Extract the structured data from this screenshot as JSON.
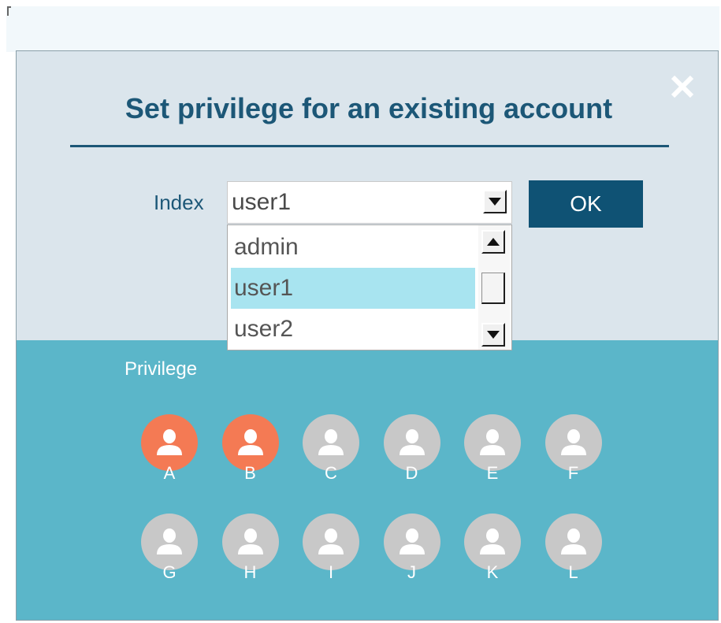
{
  "dialog": {
    "title": "Set privilege for an existing account",
    "close_icon": "close-icon",
    "index_label": "Index",
    "selected_value": "user1",
    "ok_label": "OK",
    "privilege_label": "Privilege",
    "dropdown_options": [
      "admin",
      "user1",
      "user2"
    ],
    "highlighted_option": "user1"
  },
  "privileges": [
    {
      "letter": "A",
      "active": true
    },
    {
      "letter": "B",
      "active": true
    },
    {
      "letter": "C",
      "active": false
    },
    {
      "letter": "D",
      "active": false
    },
    {
      "letter": "E",
      "active": false
    },
    {
      "letter": "F",
      "active": false
    },
    {
      "letter": "G",
      "active": false
    },
    {
      "letter": "H",
      "active": false
    },
    {
      "letter": "I",
      "active": false
    },
    {
      "letter": "J",
      "active": false
    },
    {
      "letter": "K",
      "active": false
    },
    {
      "letter": "L",
      "active": false
    }
  ],
  "colors": {
    "title": "#1c5777",
    "header_bg": "#dbe5ec",
    "body_bg": "#5bb6c9",
    "ok_button": "#0f5274",
    "active_user": "#f47a54",
    "inactive_user": "#c8c8c8",
    "selected_option": "#a8e4f0"
  }
}
